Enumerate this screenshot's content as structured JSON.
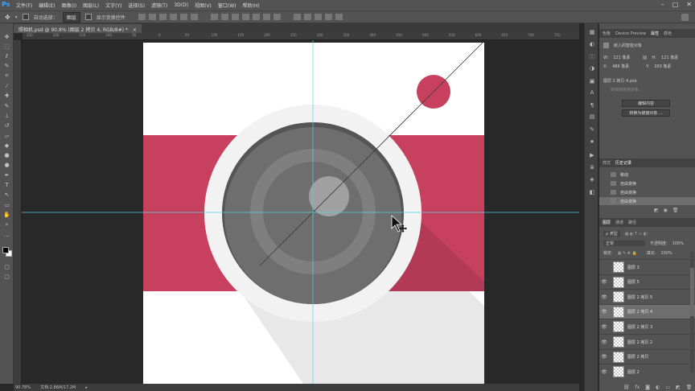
{
  "app": {
    "logo": "Ps"
  },
  "menu": [
    "文件(F)",
    "编辑(E)",
    "图像(I)",
    "图层(L)",
    "文字(Y)",
    "选择(S)",
    "滤镜(T)",
    "3D(D)",
    "视图(V)",
    "窗口(W)",
    "帮助(H)"
  ],
  "options": {
    "auto_select_label": "自动选择：",
    "auto_select_value": "图层",
    "transform_label": "显示变换控件"
  },
  "document": {
    "tab_title": "照相机.psd @ 90.8% (图层 2 拷贝 4, RGB/8#) *",
    "close": "×"
  },
  "rulers": {
    "top_ticks": [
      "250",
      "200",
      "150",
      "100",
      "50",
      "0",
      "50",
      "100",
      "150",
      "200",
      "250",
      "300",
      "350",
      "400",
      "450",
      "500",
      "550",
      "600",
      "650",
      "700",
      "750"
    ]
  },
  "status": {
    "zoom": "90.78%",
    "doc": "文档:2.86M/17.2M"
  },
  "tools": [
    {
      "icon": "move-icon",
      "glyph": "✥"
    },
    {
      "icon": "marquee-icon",
      "glyph": "⬚"
    },
    {
      "icon": "lasso-icon",
      "glyph": "ℓ"
    },
    {
      "icon": "quick-select-icon",
      "glyph": "✎"
    },
    {
      "icon": "crop-icon",
      "glyph": "⌗"
    },
    {
      "icon": "eyedropper-icon",
      "glyph": "⁄"
    },
    {
      "icon": "healing-icon",
      "glyph": "✚"
    },
    {
      "icon": "brush-icon",
      "glyph": "✎"
    },
    {
      "icon": "stamp-icon",
      "glyph": "⊥"
    },
    {
      "icon": "history-brush-icon",
      "glyph": "↺"
    },
    {
      "icon": "eraser-icon",
      "glyph": "▱"
    },
    {
      "icon": "bucket-icon",
      "glyph": "◆"
    },
    {
      "icon": "blur-icon",
      "glyph": "●"
    },
    {
      "icon": "dodge-icon",
      "glyph": "●"
    },
    {
      "icon": "pen-icon",
      "glyph": "✒"
    },
    {
      "icon": "type-icon",
      "glyph": "T"
    },
    {
      "icon": "path-select-icon",
      "glyph": "↖"
    },
    {
      "icon": "rectangle-icon",
      "glyph": "▭"
    },
    {
      "icon": "hand-icon",
      "glyph": "✋"
    },
    {
      "icon": "zoom-icon",
      "glyph": "⌕"
    },
    {
      "icon": "more-icon",
      "glyph": "…"
    }
  ],
  "panels": {
    "props_tabs": [
      "色板",
      "Device Preview",
      "属性",
      "颜色"
    ],
    "props_active": "属性",
    "smart_object_label": "嵌入的智能对象",
    "w_label": "W:",
    "w_value": "121 像素",
    "h_label": "H:",
    "h_value": "121 像素",
    "x_label": "X:",
    "x_value": "486 像素",
    "y_label": "Y:",
    "y_value": "393 像素",
    "file_label": "图层 2 拷贝 4.psb",
    "convert_link": "转换到链接对象...",
    "edit_btn": "编辑内容",
    "convert_btn": "转换为链接对象 ...",
    "hist_tabs": [
      "样式",
      "历史记录"
    ],
    "hist_active": "历史记录",
    "history": [
      "移动",
      "自由变换",
      "自由变换",
      "自由变换"
    ],
    "layers_tabs": [
      "图层",
      "通道",
      "路径"
    ],
    "layers_active": "图层",
    "filter_label": "ρ 类型",
    "blend_mode": "正常",
    "opacity_label": "不透明度:",
    "opacity_value": "100%",
    "lock_label": "锁定:",
    "fill_label": "填充:",
    "fill_value": "100%",
    "layers": [
      "图层 3",
      "图层 5",
      "图层 2 拷贝 5",
      "图层 2 拷贝 4",
      "图层 2 拷贝 3",
      "图层 2 拷贝 2",
      "图层 2 拷贝",
      "图层 2"
    ],
    "selected_layer": "图层 2 拷贝 4"
  },
  "colors": {
    "accent": "#c7415f",
    "guide": "#4fd6e6"
  }
}
